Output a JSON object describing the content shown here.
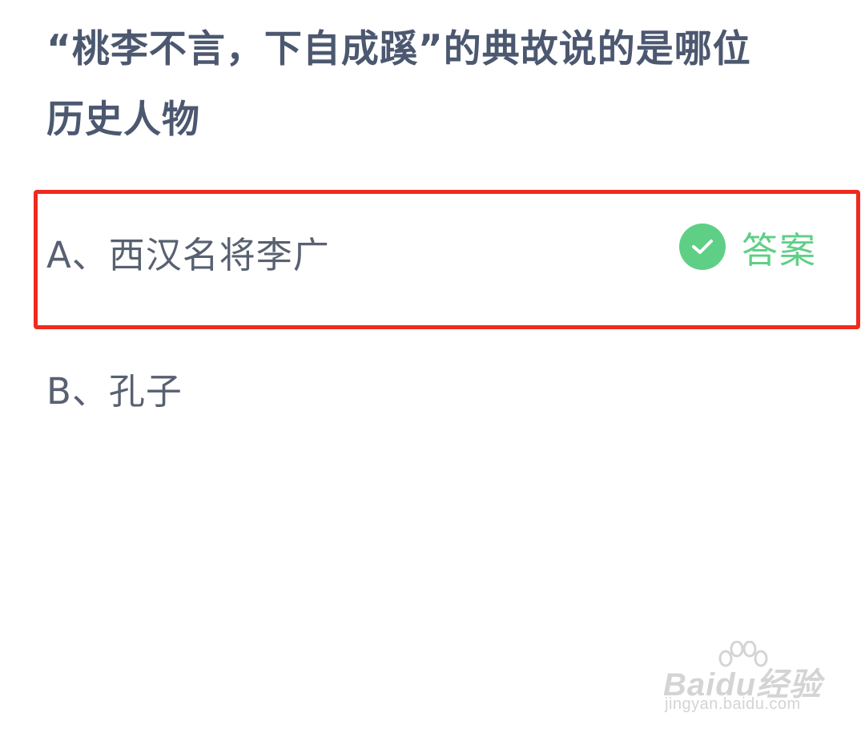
{
  "question": {
    "line1": "“桃李不言，下自成蹊”的典故说的是哪位",
    "line2": "历史人物"
  },
  "options": [
    {
      "label": "A、西汉名将李广",
      "is_answer": true
    },
    {
      "label": "B、孔子",
      "is_answer": false
    }
  ],
  "answer_tag": {
    "label": "答案",
    "icon": "check-circle-icon",
    "color": "#5fcf86"
  },
  "highlight": {
    "color": "#ef2a1f"
  },
  "watermark": {
    "logo_text": "Baidu经验",
    "url": "jingyan.baidu.com"
  }
}
